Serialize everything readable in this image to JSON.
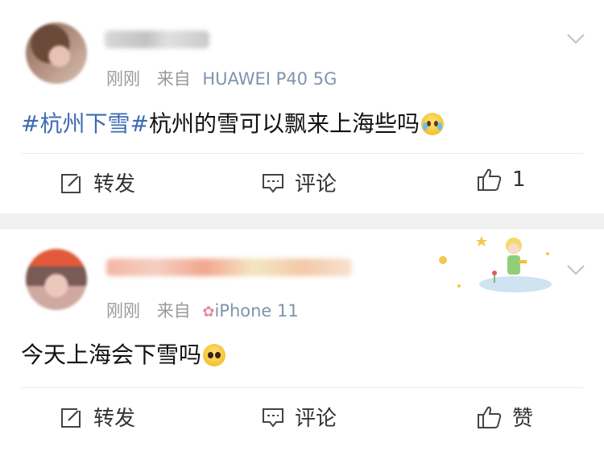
{
  "posts": [
    {
      "time": "刚刚",
      "from_label": "来自",
      "source": "HUAWEI P40 5G",
      "topic": "#杭州下雪#",
      "text": "杭州的雪可以飘来上海些吗",
      "emoji": "crying-face-emoji",
      "actions": {
        "repost": "转发",
        "comment": "评论",
        "like": "1"
      }
    },
    {
      "time": "刚刚",
      "from_label": "来自",
      "source_icon": "flower-icon",
      "source": "iPhone 11",
      "text": "今天上海会下雪吗",
      "emoji": "pleading-face-emoji",
      "actions": {
        "repost": "转发",
        "comment": "评论",
        "like": "赞"
      }
    }
  ],
  "colors": {
    "topic": "#3e6bb3",
    "meta": "#9a9a9a",
    "source": "#7f93ad",
    "separator": "#f1f1f1"
  }
}
